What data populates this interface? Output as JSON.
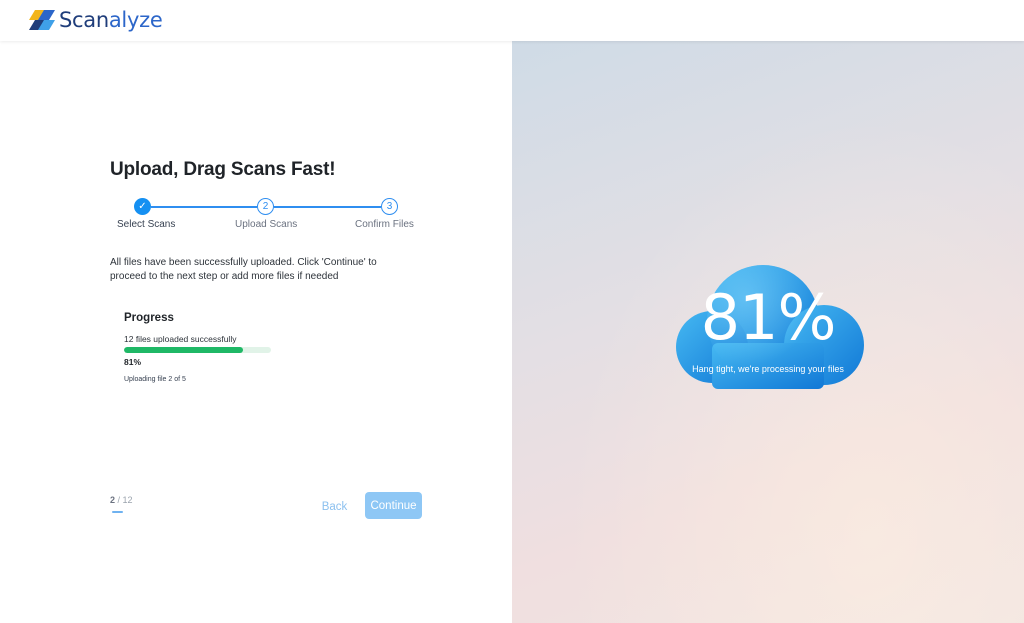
{
  "brand": {
    "name_part1": "Scan",
    "name_part2": "alyze"
  },
  "page": {
    "title": "Upload, Drag Scans Fast!"
  },
  "stepper": {
    "steps": [
      {
        "label": "Select Scans",
        "marker": "✓",
        "state": "done"
      },
      {
        "label": "Upload Scans",
        "marker": "2",
        "state": "todo"
      },
      {
        "label": "Confirm Files",
        "marker": "3",
        "state": "todo"
      }
    ]
  },
  "description": "All files have been successfully uploaded. Click 'Continue' to proceed to the next step or add more files if needed",
  "progress": {
    "title": "Progress",
    "status": "12 files uploaded successfully",
    "percent_label": "81%",
    "percent_value": 81,
    "file_status": "Uploading file 2 of 5"
  },
  "pager": {
    "current": "2",
    "separator": " / ",
    "total": "12"
  },
  "actions": {
    "back_label": "Back",
    "continue_label": "Continue"
  },
  "cloud": {
    "percent": "81%",
    "message": "Hang tight, we're processing your files"
  },
  "colors": {
    "accent": "#1590f2",
    "progress_fill": "#1fb866",
    "continue_disabled": "#8ec7f5",
    "brand_dark": "#1f3d7a"
  }
}
